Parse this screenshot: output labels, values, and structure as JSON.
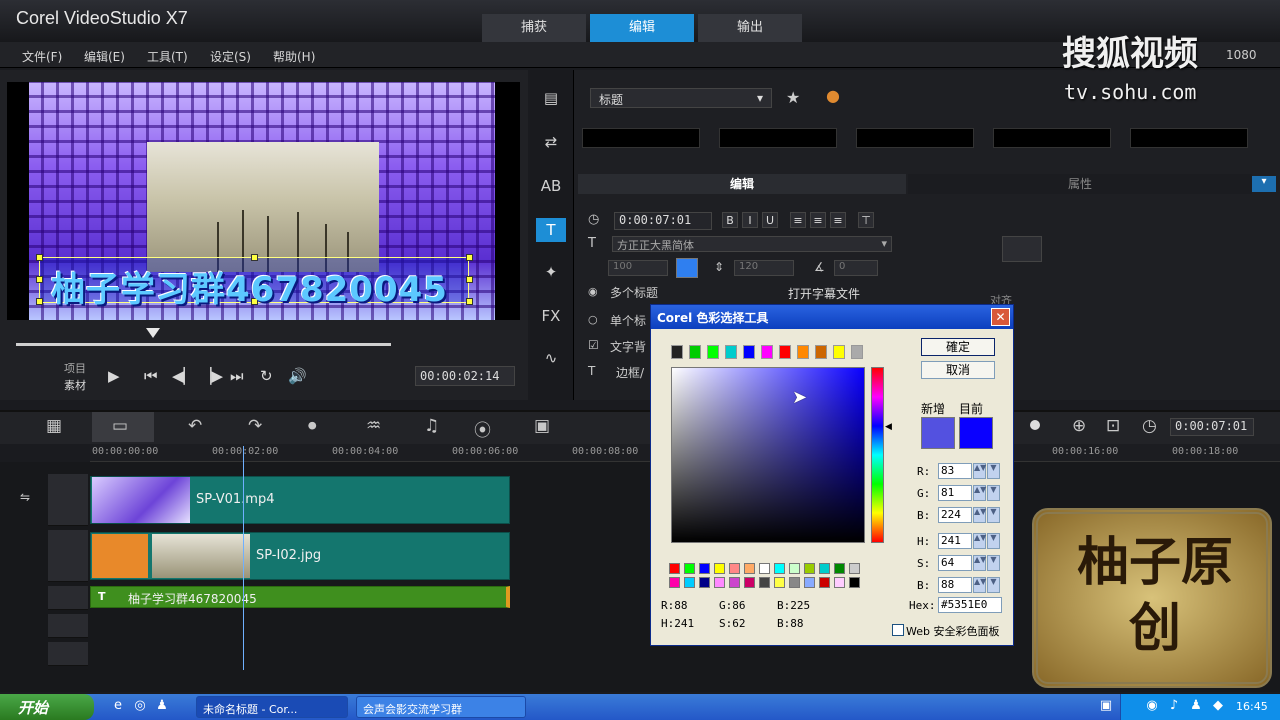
{
  "app": {
    "title": "Corel VideoStudio X7",
    "mode_tabs": [
      "捕获",
      "编辑",
      "输出"
    ],
    "menu": [
      "文件(F)",
      "编辑(E)",
      "工具(T)",
      "设定(S)",
      "帮助(H)"
    ]
  },
  "watermark": {
    "logo_text": "搜狐视频",
    "url": "tv.sohu.com",
    "corner_text": "1080",
    "stamp_text": "柚子原创"
  },
  "preview": {
    "overlay_text": "柚子学习群467820045",
    "mode_project": "项目",
    "mode_clip": "素材",
    "timecode": "00:00:02:14",
    "playback_icons": [
      "play-icon",
      "prev-icon",
      "step-back-icon",
      "step-forward-icon",
      "next-icon",
      "repeat-icon",
      "volume-icon"
    ]
  },
  "options": {
    "library_select": "标题",
    "tab_edit": "编辑",
    "tab_attributes": "属性",
    "duration": "0:00:07:01",
    "format_buttons": [
      "B",
      "I",
      "U"
    ],
    "font": "方正正大黑简体",
    "font_size": "100",
    "line_spacing": "120",
    "angle": "0",
    "multi_title": "多个标题",
    "single_title": "单个标",
    "text_background": "文字背",
    "border_label": "边框/",
    "open_subtitle": "打开字幕文件",
    "alignment": "对齐",
    "side_icons": [
      "film-icon",
      "transition-icon",
      "ab-icon",
      "title-t-icon",
      "graphic-icon",
      "fx-icon",
      "path-icon"
    ]
  },
  "timeline": {
    "timecodes": [
      "00:00:00:00",
      "00:00:02:00",
      "00:00:04:00",
      "00:00:06:00",
      "00:00:08:00",
      "00:00:16:00",
      "00:00:18:00"
    ],
    "zoom_timecode": "0:00:07:01",
    "clips": {
      "video": "SP-V01.mp4",
      "overlay": "SP-I02.jpg",
      "title": "柚子学习群467820045"
    }
  },
  "color_dialog": {
    "title": "Corel 色彩选择工具",
    "ok": "確定",
    "cancel": "取消",
    "new_label": "新增",
    "current_label": "目前",
    "new_color": "#5351E0",
    "current_color": "#0A00FF",
    "fields": {
      "R": "83",
      "G": "81",
      "B": "224",
      "H": "241",
      "S": "64",
      "V": "88"
    },
    "readout_line1": [
      "R:88",
      "G:86",
      "B:225"
    ],
    "readout_line2": [
      "H:241",
      "S:62",
      "B:88"
    ],
    "hex_label": "Hex:",
    "hex_value": "#5351E0",
    "web_safe_label": "Web 安全彩色面板",
    "recent_colors": [
      "#222222",
      "#00cc00",
      "#00ff00",
      "#00cccc",
      "#0000ff",
      "#ff00ff",
      "#ff0000",
      "#ff8800",
      "#cc6600",
      "#ffff00",
      "#aaaaaa"
    ],
    "palette_row1": [
      "#ff0000",
      "#00ff00",
      "#0000ff",
      "#ffff00",
      "#ff8888",
      "#ffaa66",
      "#ffffff",
      "#00ffff",
      "#ccffcc",
      "#99cc00",
      "#00cccc",
      "#008800",
      "#cccccc"
    ],
    "palette_row2": [
      "#ff00aa",
      "#00ccff",
      "#000088",
      "#ff88ff",
      "#cc44cc",
      "#cc0066",
      "#444444",
      "#ffff44",
      "#888888",
      "#88aaff",
      "#cc0000",
      "#ffccff",
      "#000000"
    ]
  },
  "taskbar": {
    "start": "开始",
    "tasks": [
      "未命名标题 - Cor...",
      "会声会影交流学习群"
    ],
    "clock": "16:45"
  }
}
